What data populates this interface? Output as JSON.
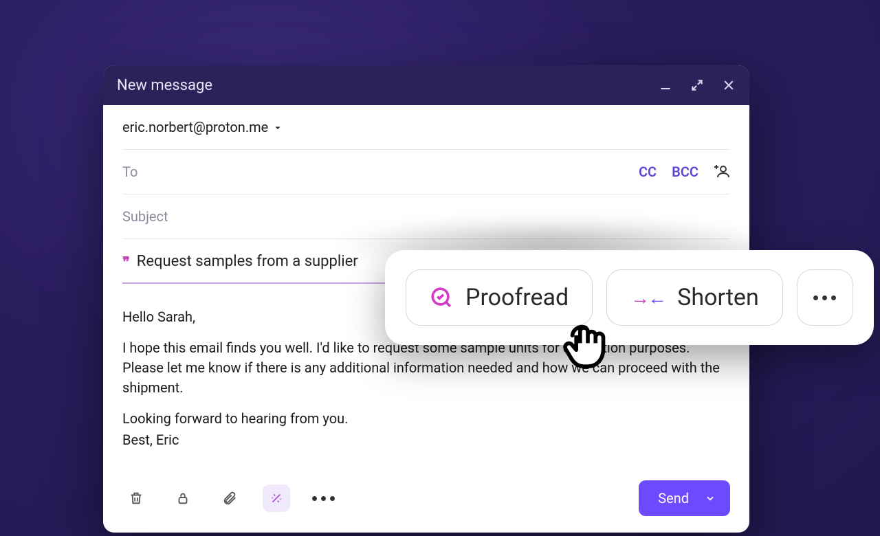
{
  "window": {
    "title": "New message"
  },
  "compose": {
    "from": "eric.norbert@proton.me",
    "to_label": "To",
    "cc_label": "CC",
    "bcc_label": "BCC",
    "subject_placeholder": "Subject"
  },
  "ai_prompt": {
    "text": "Request samples from a supplier"
  },
  "body": {
    "greeting": "Hello Sarah,",
    "p1": "I hope this email finds you well. I'd like to request some sample units for evaluation purposes. Please let me know if there is any additional information needed and how we can proceed with the shipment.",
    "p2": "Looking forward to hearing from you.",
    "signature": "Best, Eric"
  },
  "popover": {
    "proofread": "Proofread",
    "shorten": "Shorten"
  },
  "send": {
    "label": "Send"
  }
}
